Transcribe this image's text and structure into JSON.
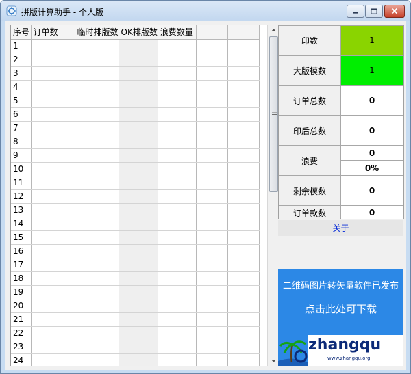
{
  "window": {
    "title": "拼版计算助手 - 个人版"
  },
  "grid": {
    "headers": [
      "序号",
      "订单数",
      "临时排版数",
      "OK排版数",
      "浪费数量",
      "",
      ""
    ],
    "rows": [
      "1",
      "2",
      "3",
      "4",
      "5",
      "6",
      "7",
      "8",
      "9",
      "10",
      "11",
      "12",
      "13",
      "14",
      "15",
      "16",
      "17",
      "18",
      "19",
      "20",
      "21",
      "22",
      "23",
      "24"
    ]
  },
  "stats": {
    "print_count": {
      "label": "印数",
      "value": "1",
      "color": "#8ad400"
    },
    "plate_count": {
      "label": "大版模数",
      "value": "1",
      "color": "#00ee00"
    },
    "order_total": {
      "label": "订单总数",
      "value": "0"
    },
    "post_print_total": {
      "label": "印后总数",
      "value": "0"
    },
    "waste": {
      "label": "浪费",
      "value": "0",
      "percent": "0%"
    },
    "remaining": {
      "label": "剩余模数",
      "value": "0"
    },
    "order_amount": {
      "label": "订单款数",
      "value": "0"
    }
  },
  "about_label": "关于",
  "ad": {
    "line1": "二维码图片转矢量软件已发布",
    "line2": "点击此处可下载",
    "logo": "zhangqu",
    "url": "www.zhangqu.org"
  }
}
